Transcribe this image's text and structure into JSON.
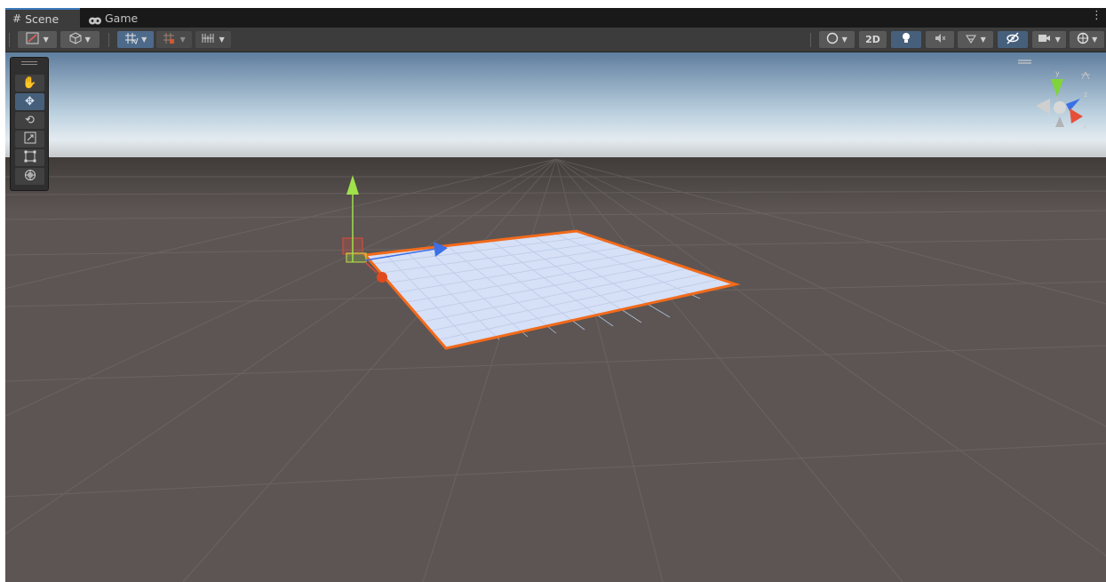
{
  "tabs": [
    {
      "label": "Scene",
      "icon": "grid-icon"
    },
    {
      "label": "Game",
      "icon": "gamepad-icon"
    }
  ],
  "toolbar_right": {
    "two_d_label": "2D"
  },
  "tools": [
    {
      "name": "hand-tool",
      "icon": "hand-icon"
    },
    {
      "name": "move-tool",
      "icon": "move-icon"
    },
    {
      "name": "rotate-tool",
      "icon": "rotate-icon"
    },
    {
      "name": "scale-tool",
      "icon": "scale-icon"
    },
    {
      "name": "rect-tool",
      "icon": "rect-icon"
    },
    {
      "name": "transform-tool",
      "icon": "transform-icon"
    }
  ],
  "gizmo": {
    "axes": [
      "y",
      "z",
      "x"
    ]
  },
  "colors": {
    "selection_outline": "#f26a1b",
    "plane_fill": "#dce8ff",
    "ground": "#5c5553",
    "sky": "#c9d9e6",
    "accent": "#3a79bb"
  }
}
